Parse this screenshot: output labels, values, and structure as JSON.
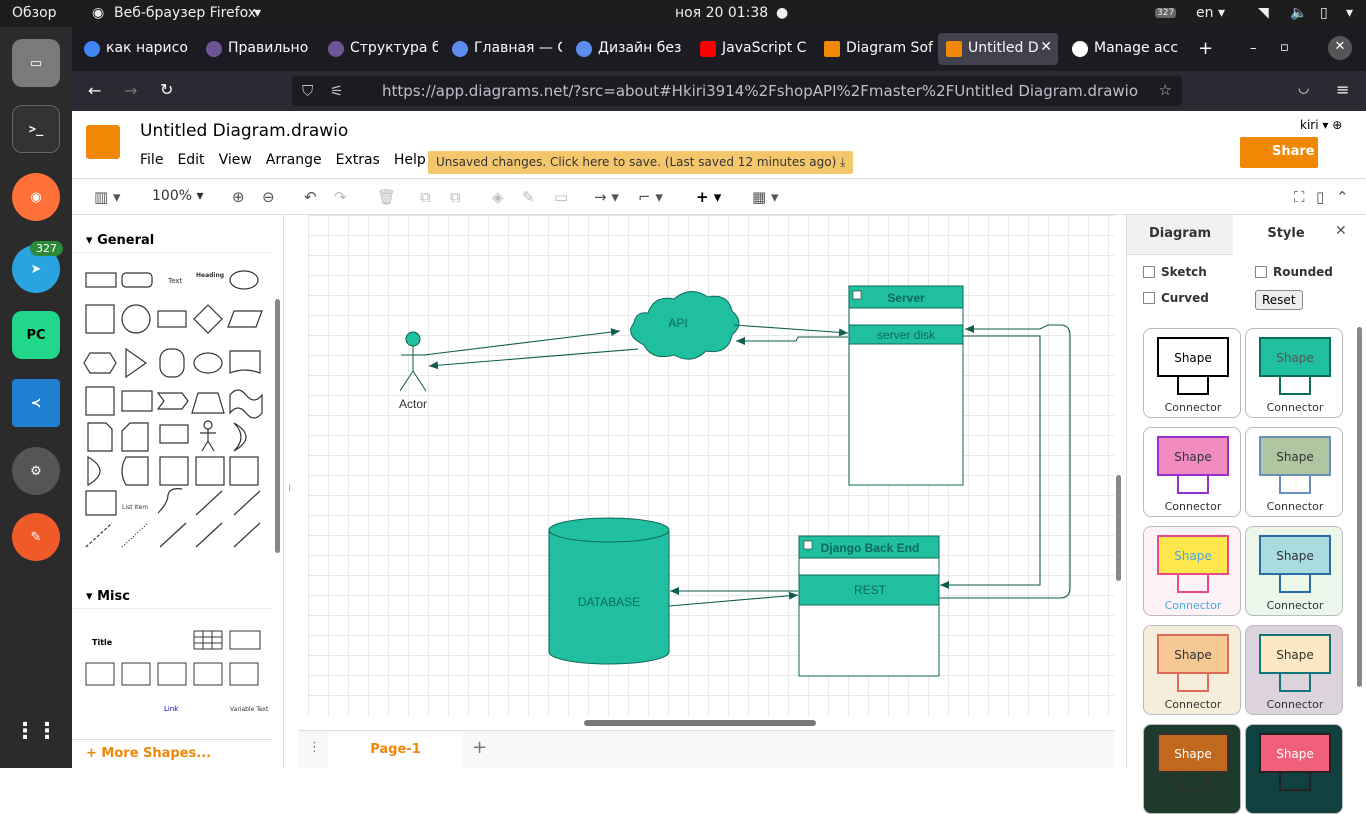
{
  "topbar": {
    "overview": "Обзор",
    "app": "Веб-браузер Firefox",
    "datetime": "ноя 20  01:38",
    "lang": "en",
    "badge": "327"
  },
  "dock": {
    "telegram_badge": "327"
  },
  "tabs": [
    "как нарисо",
    "Правильно",
    "Структура б",
    "Главная — С",
    "Дизайн без",
    "JavaScript С",
    "Diagram Sof",
    "Untitled D",
    "Manage acc"
  ],
  "url": "https://app.diagrams.net/?src=about#Hkiri3914%2FshopAPI%2Fmaster%2FUntitled Diagram.drawio",
  "app": {
    "title": "Untitled Diagram.drawio",
    "menus": [
      "File",
      "Edit",
      "View",
      "Arrange",
      "Extras",
      "Help"
    ],
    "unsaved": "Unsaved changes. Click here to save. (Last saved 12 minutes ago)",
    "share": "Share",
    "user": "kiri",
    "zoom": "100%"
  },
  "left": {
    "general": "General",
    "misc": "Misc",
    "more": "+ More Shapes...",
    "shape_labels": {
      "text": "Text",
      "heading": "Heading",
      "list_item": "List Item",
      "title": "Title",
      "link": "Link",
      "variable_text": "Variable Text"
    }
  },
  "diagram": {
    "actor": "Actor",
    "api": "API",
    "server": "Server",
    "server_disk": "server disk",
    "django": "Django Back End",
    "rest": "REST",
    "database": "DATABASE"
  },
  "page": "Page-1",
  "right": {
    "tabs": [
      "Diagram",
      "Style"
    ],
    "sketch": "Sketch",
    "rounded": "Rounded",
    "curved": "Curved",
    "reset": "Reset",
    "swatches": [
      {
        "shape": "Shape",
        "connector": "Connector",
        "fill": "#ffffff",
        "stroke": "#000000",
        "bg": "#ffffff",
        "text": "#000000"
      },
      {
        "shape": "Shape",
        "connector": "Connector",
        "fill": "#1fbfa0",
        "stroke": "#0e6b5a",
        "bg": "#ffffff",
        "text": "#555555"
      },
      {
        "shape": "Shape",
        "connector": "Connector",
        "fill": "#f08cc0",
        "stroke": "#9932cc",
        "bg": "#ffffff",
        "text": "#333333"
      },
      {
        "shape": "Shape",
        "connector": "Connector",
        "fill": "#aec7a0",
        "stroke": "#6c8ebf",
        "bg": "#ffffff",
        "text": "#333333"
      },
      {
        "shape": "Shape",
        "connector": "Connector",
        "fill": "#fde74c",
        "stroke": "#e84a8e",
        "bg": "#fdf3f7",
        "text": "#4aa8e0"
      },
      {
        "shape": "Shape",
        "connector": "Connector",
        "fill": "#a9dce0",
        "stroke": "#2b6ca3",
        "bg": "#eaf7ea",
        "text": "#333333"
      },
      {
        "shape": "Shape",
        "connector": "Connector",
        "fill": "#f5c894",
        "stroke": "#e06a5a",
        "bg": "#f5eedb",
        "text": "#333333"
      },
      {
        "shape": "Shape",
        "connector": "Connector",
        "fill": "#fde8c4",
        "stroke": "#11757a",
        "bg": "#dcd3dd",
        "text": "#333333"
      },
      {
        "shape": "Shape",
        "connector": "",
        "fill": "#c0681e",
        "stroke": "#333333",
        "bg": "#1d3a2a",
        "text": "#ffffff"
      },
      {
        "shape": "Shape",
        "connector": "",
        "fill": "#f0607a",
        "stroke": "#222222",
        "bg": "#114040",
        "text": "#ffffff"
      }
    ]
  }
}
